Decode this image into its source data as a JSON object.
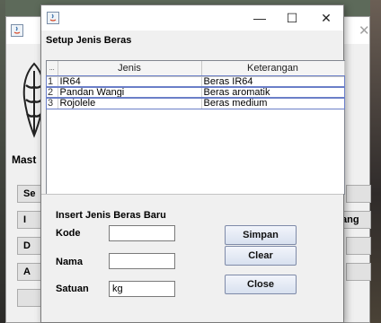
{
  "background_window": {
    "title_partial": "Mast",
    "buttons": [
      "Se",
      "I",
      "D",
      "A",
      "",
      "",
      "ang",
      "",
      ""
    ]
  },
  "dialog": {
    "title": "",
    "controls": {
      "minimize": "—",
      "maximize": "☐",
      "close": "✕"
    },
    "heading": "Setup Jenis Beras",
    "table": {
      "columns": [
        "...",
        "Jenis",
        "Keterangan"
      ],
      "rows": [
        {
          "no": "1",
          "jenis": "IR64",
          "keterangan": "Beras IR64"
        },
        {
          "no": "2",
          "jenis": "Pandan Wangi",
          "keterangan": "Beras aromatik"
        },
        {
          "no": "3",
          "jenis": "Rojolele",
          "keterangan": "Beras medium"
        }
      ]
    },
    "form": {
      "title": "Insert Jenis Beras Baru",
      "kode_label": "Kode",
      "kode_value": "",
      "nama_label": "Nama",
      "nama_value": "",
      "satuan_label": "Satuan",
      "satuan_value": "kg"
    },
    "buttons": {
      "simpan": "Simpan",
      "clear": "Clear",
      "close": "Close"
    }
  }
}
